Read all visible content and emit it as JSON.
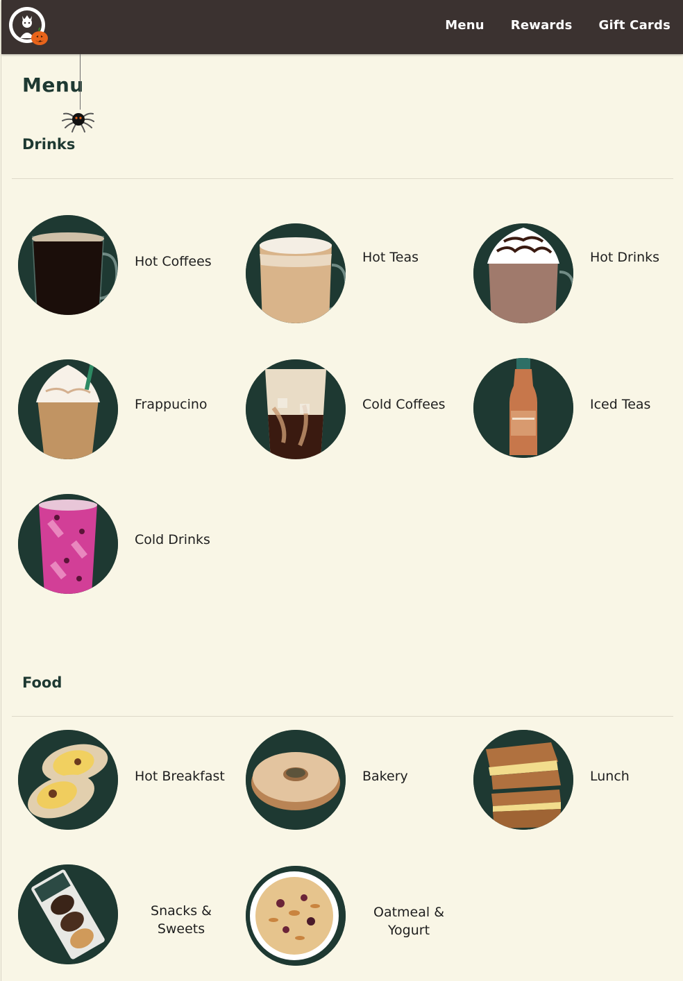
{
  "header": {
    "logo_icon": "starbucks-siren-logo-with-pumpkin",
    "nav": [
      {
        "label": "Menu"
      },
      {
        "label": "Rewards"
      },
      {
        "label": "Gift Cards"
      }
    ],
    "bg_color": "#3b3230"
  },
  "page": {
    "title": "Menu",
    "decoration_icon": "hanging-spider-icon"
  },
  "drinks": {
    "heading": "Drinks",
    "items": [
      {
        "label": "Hot Coffees",
        "icon": "hot-coffee-mug-icon"
      },
      {
        "label": "Hot Teas",
        "icon": "hot-tea-latte-mug-icon"
      },
      {
        "label": "Hot Drinks",
        "icon": "hot-chocolate-whipped-icon"
      },
      {
        "label": "Frappucino",
        "icon": "frappuccino-cup-icon"
      },
      {
        "label": "Cold Coffees",
        "icon": "iced-coffee-glass-icon"
      },
      {
        "label": "Iced Teas",
        "icon": "iced-tea-bottle-icon"
      },
      {
        "label": "Cold Drinks",
        "icon": "pink-refresher-glass-icon"
      }
    ]
  },
  "food": {
    "heading": "Food",
    "items": [
      {
        "label": "Hot Breakfast",
        "icon": "breakfast-wrap-icon"
      },
      {
        "label": "Bakery",
        "icon": "bagel-icon"
      },
      {
        "label": "Lunch",
        "icon": "grilled-sandwich-icon"
      },
      {
        "label": "Snacks & Sweets",
        "icon": "madeleines-pack-icon"
      },
      {
        "label": "Oatmeal & Yogurt",
        "icon": "oatmeal-bowl-icon"
      }
    ]
  },
  "colors": {
    "page_bg": "#f9f6e6",
    "brand_green": "#1e3932",
    "header_bg": "#3b3230"
  }
}
